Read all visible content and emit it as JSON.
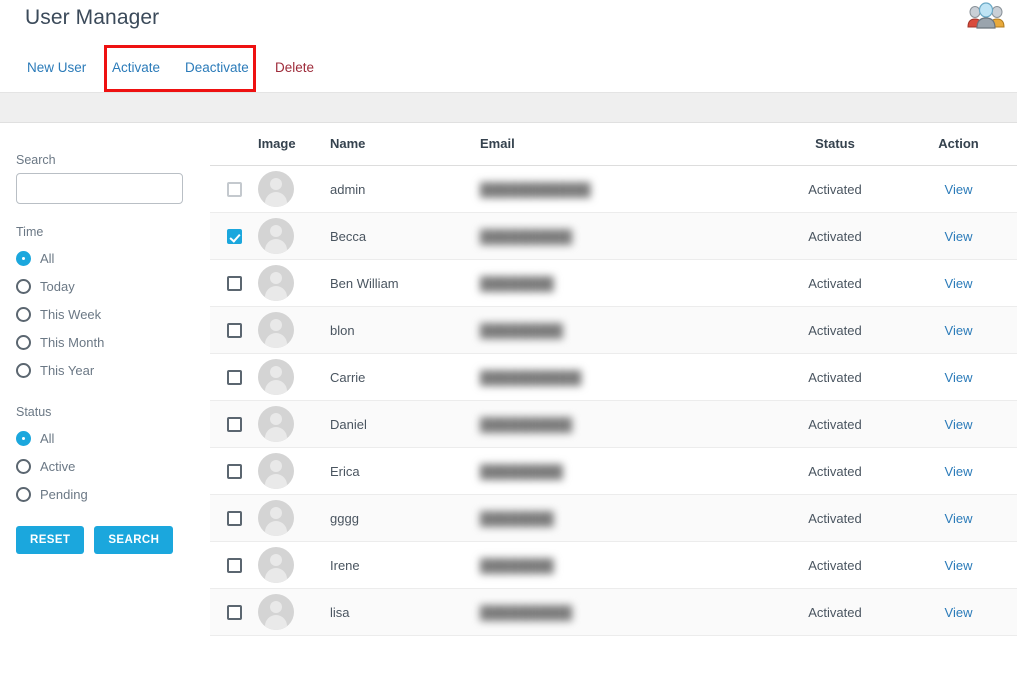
{
  "header": {
    "title": "User Manager",
    "group_icon": "users-group-icon"
  },
  "toolbar": {
    "new_user": "New User",
    "activate": "Activate",
    "deactivate": "Deactivate",
    "delete": "Delete",
    "highlight_color": "#ee1111",
    "link_color": "#2b7bb9",
    "delete_color": "#9e2b3a"
  },
  "sidebar": {
    "search_label": "Search",
    "search_value": "",
    "search_placeholder": "",
    "time": {
      "label": "Time",
      "options": [
        {
          "label": "All",
          "selected": true
        },
        {
          "label": "Today",
          "selected": false
        },
        {
          "label": "This Week",
          "selected": false
        },
        {
          "label": "This Month",
          "selected": false
        },
        {
          "label": "This Year",
          "selected": false
        }
      ]
    },
    "status": {
      "label": "Status",
      "options": [
        {
          "label": "All",
          "selected": true
        },
        {
          "label": "Active",
          "selected": false
        },
        {
          "label": "Pending",
          "selected": false
        }
      ]
    },
    "reset_button": "RESET",
    "search_button": "SEARCH",
    "accent_color": "#1ba7dd"
  },
  "table": {
    "columns": [
      "",
      "Image",
      "Name",
      "Email",
      "Status",
      "Action"
    ],
    "rows": [
      {
        "checked": false,
        "checkbox_style": "light",
        "avatar": "user-avatar",
        "name": "admin",
        "email": "redacted",
        "status": "Activated",
        "action": "View"
      },
      {
        "checked": true,
        "checkbox_style": "dark",
        "avatar": "user-avatar",
        "name": "Becca",
        "email": "redacted",
        "status": "Activated",
        "action": "View"
      },
      {
        "checked": false,
        "checkbox_style": "dark",
        "avatar": "user-avatar",
        "name": "Ben William",
        "email": "redacted",
        "status": "Activated",
        "action": "View"
      },
      {
        "checked": false,
        "checkbox_style": "dark",
        "avatar": "user-avatar",
        "name": "blon",
        "email": "redacted",
        "status": "Activated",
        "action": "View"
      },
      {
        "checked": false,
        "checkbox_style": "dark",
        "avatar": "user-avatar",
        "name": "Carrie",
        "email": "redacted",
        "status": "Activated",
        "action": "View"
      },
      {
        "checked": false,
        "checkbox_style": "dark",
        "avatar": "user-avatar",
        "name": "Daniel",
        "email": "redacted",
        "status": "Activated",
        "action": "View"
      },
      {
        "checked": false,
        "checkbox_style": "dark",
        "avatar": "user-avatar",
        "name": "Erica",
        "email": "redacted",
        "status": "Activated",
        "action": "View"
      },
      {
        "checked": false,
        "checkbox_style": "dark",
        "avatar": "user-avatar",
        "name": "gggg",
        "email": "redacted",
        "status": "Activated",
        "action": "View"
      },
      {
        "checked": false,
        "checkbox_style": "dark",
        "avatar": "user-avatar",
        "name": "Irene",
        "email": "redacted",
        "status": "Activated",
        "action": "View"
      },
      {
        "checked": false,
        "checkbox_style": "dark",
        "avatar": "user-avatar",
        "name": "lisa",
        "email": "redacted",
        "status": "Activated",
        "action": "View"
      }
    ]
  }
}
